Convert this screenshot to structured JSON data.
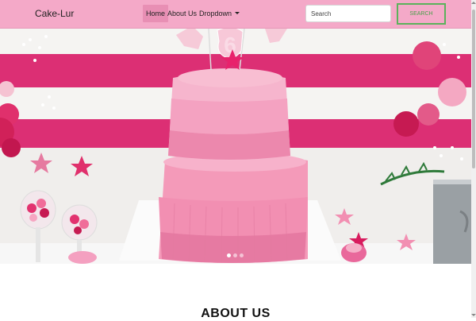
{
  "navbar": {
    "brand": "Cake-Lur",
    "links": [
      "Home",
      "About Us",
      "Dropdown"
    ],
    "search_placeholder": "Search",
    "search_button": "SEARCH"
  },
  "hero": {
    "image": "pink-tiered-birthday-cake",
    "cake_topper": "6",
    "slides": 3,
    "active_slide": 1
  },
  "about": {
    "heading": "ABOUT US"
  },
  "colors": {
    "navbar_bg": "#f4a9c8",
    "accent_green": "#5bb25b",
    "brand_pink": "#e01a6e"
  }
}
